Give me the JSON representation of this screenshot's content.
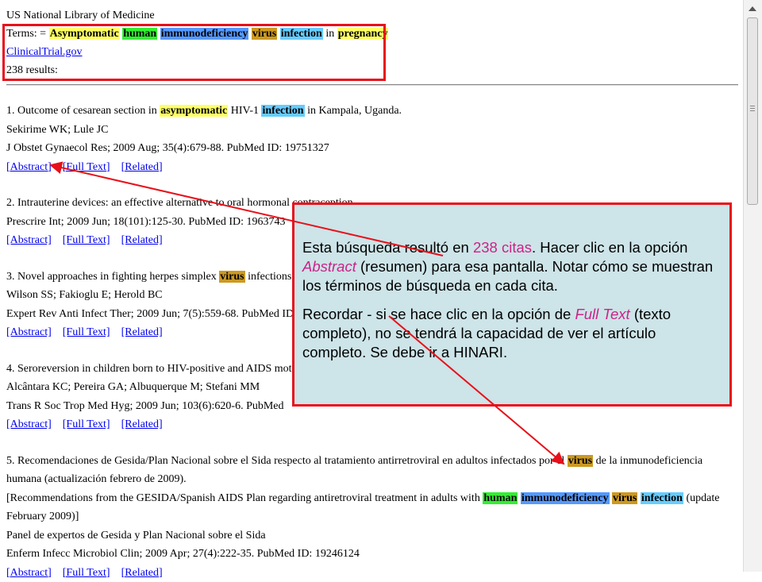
{
  "header": {
    "library": "US National Library of Medicine",
    "terms_prefix": "Terms: =",
    "terms": [
      {
        "text": "Asymptomatic",
        "color": "yellow"
      },
      {
        "text": "human",
        "color": "green"
      },
      {
        "text": "immunodeficiency",
        "color": "blue"
      },
      {
        "text": "virus",
        "color": "gold"
      },
      {
        "text": "infection",
        "color": "sky"
      }
    ],
    "in_word": "in",
    "last_term": "pregnancy",
    "source_link": "ClinicalTrial.gov",
    "results_count": "238 results:"
  },
  "links": {
    "abstract": "[Abstract]",
    "fulltext": "[Full Text]",
    "related": "[Related]"
  },
  "items": [
    {
      "title_parts": [
        "1. Outcome of cesarean section in ",
        "asymptomatic",
        " HIV-1 ",
        "infection",
        " in Kampala, Uganda."
      ],
      "authors": "Sekirime WK; Lule JC",
      "citation": "J Obstet Gynaecol Res; 2009 Aug; 35(4):679-88. PubMed ID: 19751327"
    },
    {
      "title": "2. Intrauterine devices: an effective alternative to oral hormonal contraception.",
      "citation": "Prescrire Int; 2009 Jun; 18(101):125-30. PubMed ID: 1963743"
    },
    {
      "title_parts": [
        "3. Novel approaches in fighting herpes simplex ",
        "virus",
        " infections."
      ],
      "authors": "Wilson SS; Fakioglu E; Herold BC",
      "citation": "Expert Rev Anti Infect Ther; 2009 Jun; 7(5):559-68. PubMed ID"
    },
    {
      "title": "4. Seroreversion in children born to HIV-positive and AIDS mot",
      "authors": "Alcântara KC; Pereira GA; Albuquerque M; Stefani MM",
      "citation": "Trans R Soc Trop Med Hyg; 2009 Jun; 103(6):620-6. PubMed"
    },
    {
      "title_parts": [
        "5. Recomendaciones de Gesida/Plan Nacional sobre el Sida respecto al tratamiento antirretroviral en adultos infectados por el ",
        "virus",
        " de la inmunodeficiencia humana (actualización febrero de 2009)."
      ],
      "translation_parts": [
        "[Recommendations from the GESIDA/Spanish AIDS Plan regarding antiretroviral treatment in adults with ",
        "human",
        " ",
        "immunodeficiency",
        " ",
        "virus",
        " ",
        "infection",
        " (update February 2009)]"
      ],
      "authors": "Panel de expertos de Gesida y Plan Nacional sobre el Sida",
      "citation": "Enferm Infecc Microbiol Clin; 2009 Apr; 27(4):222-35. PubMed ID: 19246124"
    }
  ],
  "callout": {
    "p1_a": "Esta búsqueda resultó en ",
    "p1_b": "238 citas",
    "p1_c": ". Hacer clic en la opción ",
    "p1_d": "Abstract",
    "p1_e": " (resumen) para esa pantalla. Notar cómo se muestran los términos de búsqueda en cada cita.",
    "p2_a": "Recordar - si se hace clic en la opción de ",
    "p2_b": "Full Text",
    "p2_c": " (texto completo), no se tendrá la capacidad de ver el artículo completo. Se debe ir a HINARI."
  },
  "colors": {
    "accent_red": "#e8101a",
    "callout_bg": "#cde4e8",
    "link": "#0000ee",
    "pink": "#cc2288"
  }
}
